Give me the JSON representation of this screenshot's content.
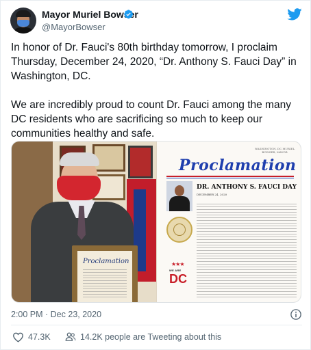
{
  "author": {
    "display_name": "Mayor Muriel Bowser",
    "handle": "@MayorBowser",
    "verified": true
  },
  "tweet": {
    "paragraph_1": "In honor of Dr. Fauci's 80th birthday tomorrow, I proclaim Thursday, December 24, 2020, “Dr. Anthony S. Fauci Day” in Washington, DC.",
    "paragraph_2": "We are incredibly proud to count Dr. Fauci among the many DC residents who are sacrificing so much to keep our communities healthy and safe."
  },
  "media": {
    "document": {
      "office": "WASHINGTON, DC MURIEL BOWSER, MAYOR",
      "title": "Proclamation",
      "heading": "DR. ANTHONY S. FAUCI DAY",
      "date": "DECEMBER 24, 2020",
      "logo_tag": "WE ARE",
      "logo_text": "DC"
    },
    "plaque_title": "Proclamation"
  },
  "meta": {
    "timestamp": "2:00 PM · Dec 23, 2020"
  },
  "engagement": {
    "likes": "47.3K",
    "people_tweeting": "14.2K people are Tweeting about this"
  },
  "icons": {
    "verified": "verified-badge-icon",
    "brand": "twitter-logo-icon",
    "info": "info-icon",
    "like": "heart-icon",
    "people": "people-icon"
  },
  "colors": {
    "brand_blue": "#1d9bf0",
    "text_primary": "#0f1419",
    "text_secondary": "#536471",
    "proclamation_blue": "#1f3fae",
    "dc_red": "#c81e28"
  }
}
